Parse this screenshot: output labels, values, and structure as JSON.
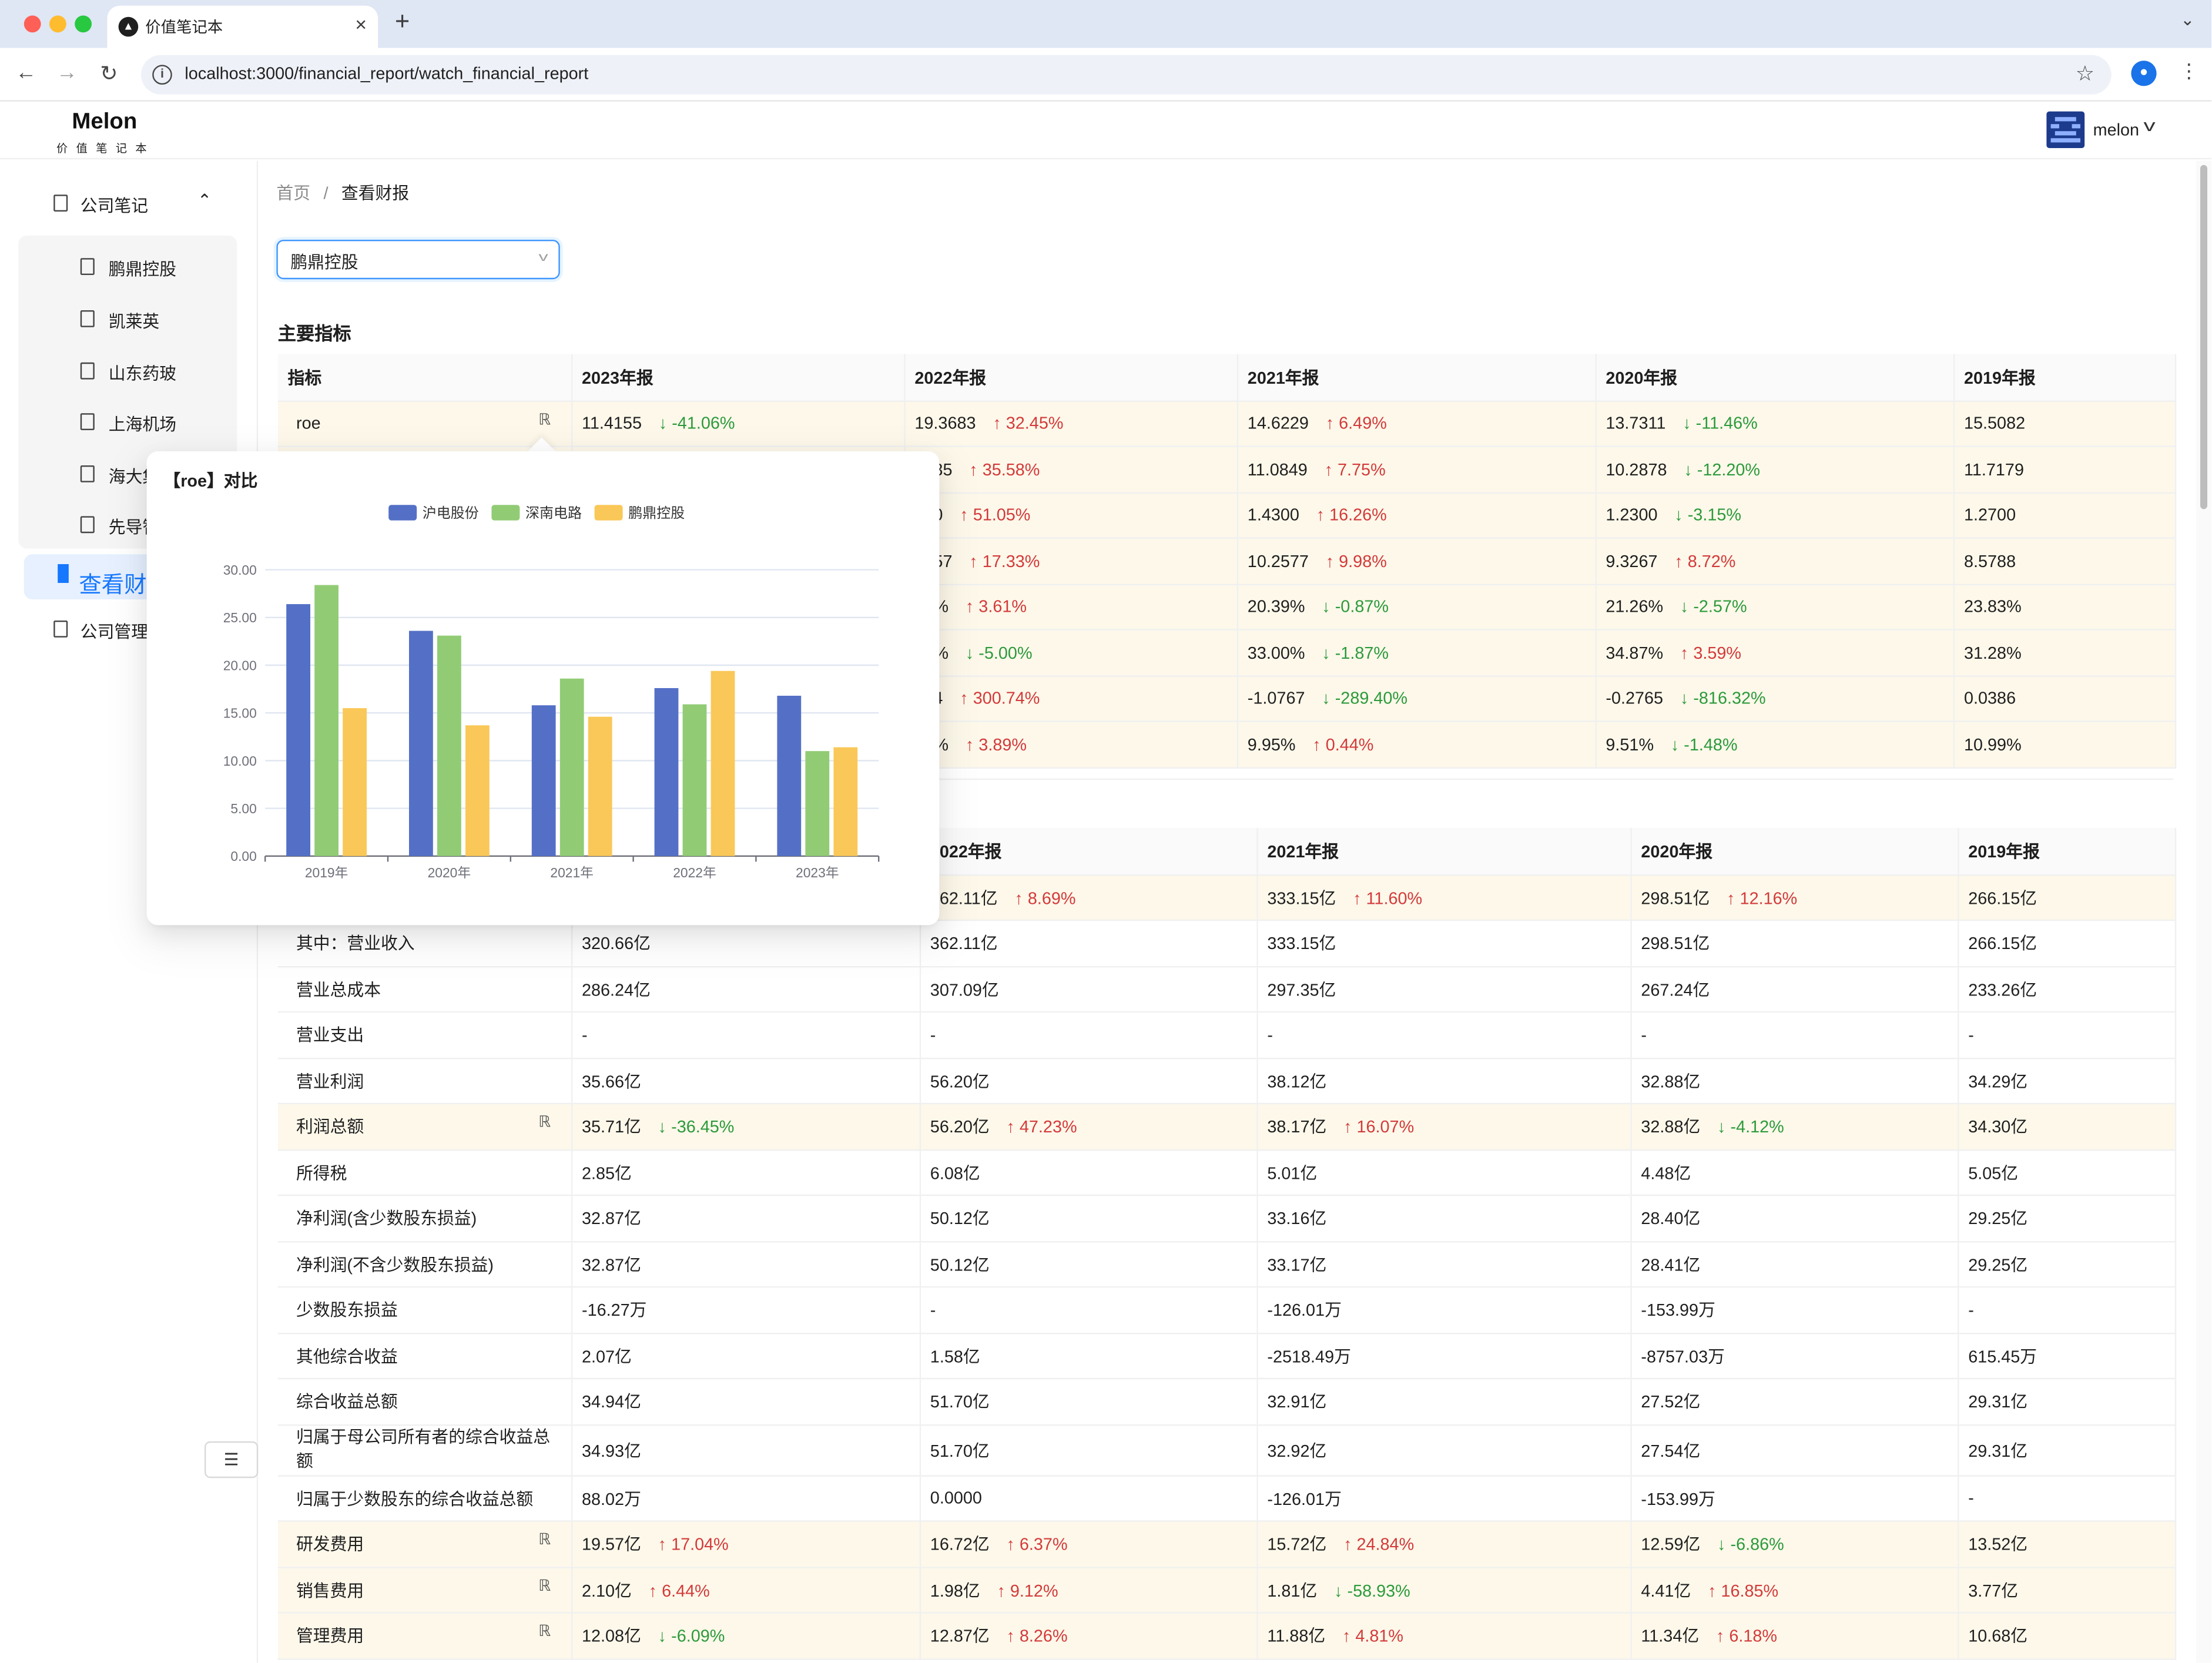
{
  "browser": {
    "tab_title": "价值笔记本",
    "url": "localhost:3000/financial_report/watch_financial_report",
    "profile_initial": "●"
  },
  "app": {
    "logo": "Melon",
    "logo_sub": "价值笔记本",
    "username": "melon"
  },
  "sidebar": {
    "group_label": "公司笔记",
    "companies": [
      "鹏鼎控股",
      "凯莱英",
      "山东药玻",
      "上海机场",
      "海大集团",
      "先导智能"
    ],
    "watch_report": "查看财报",
    "company_manage": "公司管理"
  },
  "breadcrumb": {
    "home": "首页",
    "separator": "/",
    "current": "查看财报"
  },
  "select": {
    "value": "鹏鼎控股"
  },
  "section_title": "主要指标",
  "indicators": {
    "headers": [
      "指标",
      "2023年报",
      "2022年报",
      "2021年报",
      "2020年报",
      "2019年报"
    ],
    "rows": [
      {
        "label": "roe",
        "cells": [
          {
            "v": "11.4155",
            "c": "-41.06%",
            "d": "down"
          },
          {
            "v": "19.3683",
            "c": "32.45%",
            "d": "up"
          },
          {
            "v": "14.6229",
            "c": "6.49%",
            "d": "up"
          },
          {
            "v": "13.7311",
            "c": "-11.46%",
            "d": "down"
          },
          {
            "v": "15.5082"
          }
        ]
      },
      {
        "label": "",
        "cells": [
          {
            "v": "0285",
            "c": "35.58%",
            "d": "up"
          },
          {
            "v": "11.0849",
            "c": "7.75%",
            "d": "up"
          },
          {
            "v": "10.2878",
            "c": "-12.20%",
            "d": "down"
          },
          {
            "v": "11.7179"
          }
        ]
      },
      {
        "label": "",
        "cells": [
          {
            "v": "600",
            "c": "51.05%",
            "d": "up"
          },
          {
            "v": "1.4300",
            "c": "16.26%",
            "d": "up"
          },
          {
            "v": "1.2300",
            "c": "-3.15%",
            "d": "down"
          },
          {
            "v": "1.2700"
          }
        ]
      },
      {
        "label": "",
        "cells": [
          {
            "v": "0357",
            "c": "17.33%",
            "d": "up"
          },
          {
            "v": "10.2577",
            "c": "9.98%",
            "d": "up"
          },
          {
            "v": "9.3267",
            "c": "8.72%",
            "d": "up"
          },
          {
            "v": "8.5788"
          }
        ]
      },
      {
        "label": "",
        "cells": [
          {
            "v": "00%",
            "c": "3.61%",
            "d": "up"
          },
          {
            "v": "20.39%",
            "c": "-0.87%",
            "d": "down"
          },
          {
            "v": "21.26%",
            "c": "-2.57%",
            "d": "down"
          },
          {
            "v": "23.83%"
          }
        ]
      },
      {
        "label": "",
        "cells": [
          {
            "v": "00%",
            "c": "-5.00%",
            "d": "down"
          },
          {
            "v": "33.00%",
            "c": "-1.87%",
            "d": "down"
          },
          {
            "v": "34.87%",
            "c": "3.59%",
            "d": "up"
          },
          {
            "v": "31.28%"
          }
        ]
      },
      {
        "label": "",
        "cells": [
          {
            "v": "614",
            "c": "300.74%",
            "d": "up"
          },
          {
            "v": "-1.0767",
            "c": "-289.40%",
            "d": "down"
          },
          {
            "v": "-0.2765",
            "c": "-816.32%",
            "d": "down"
          },
          {
            "v": "0.0386"
          }
        ]
      },
      {
        "label": "",
        "cells": [
          {
            "v": "84%",
            "c": "3.89%",
            "d": "up"
          },
          {
            "v": "9.95%",
            "c": "0.44%",
            "d": "up"
          },
          {
            "v": "9.51%",
            "c": "-1.48%",
            "d": "down"
          },
          {
            "v": "10.99%"
          }
        ]
      }
    ]
  },
  "income": {
    "headers": [
      "",
      "",
      "2022年报",
      "2021年报",
      "2020年报",
      "2019年报"
    ],
    "rows": [
      {
        "label": "",
        "hl": true,
        "cells": [
          {
            "v": ""
          },
          {
            "v": "362.11亿",
            "c": "8.69%",
            "d": "up"
          },
          {
            "v": "333.15亿",
            "c": "11.60%",
            "d": "up"
          },
          {
            "v": "298.51亿",
            "c": "12.16%",
            "d": "up"
          },
          {
            "v": "266.15亿"
          }
        ]
      },
      {
        "label": "其中：营业收入",
        "cells": [
          {
            "v": "320.66亿"
          },
          {
            "v": "362.11亿"
          },
          {
            "v": "333.15亿"
          },
          {
            "v": "298.51亿"
          },
          {
            "v": "266.15亿"
          }
        ]
      },
      {
        "label": "营业总成本",
        "cells": [
          {
            "v": "286.24亿"
          },
          {
            "v": "307.09亿"
          },
          {
            "v": "297.35亿"
          },
          {
            "v": "267.24亿"
          },
          {
            "v": "233.26亿"
          }
        ]
      },
      {
        "label": "营业支出",
        "cells": [
          {
            "v": "-"
          },
          {
            "v": "-"
          },
          {
            "v": "-"
          },
          {
            "v": "-"
          },
          {
            "v": "-"
          }
        ]
      },
      {
        "label": "营业利润",
        "cells": [
          {
            "v": "35.66亿"
          },
          {
            "v": "56.20亿"
          },
          {
            "v": "38.12亿"
          },
          {
            "v": "32.88亿"
          },
          {
            "v": "34.29亿"
          }
        ]
      },
      {
        "label": "利润总额",
        "hl": true,
        "icon": true,
        "cells": [
          {
            "v": "35.71亿",
            "c": "-36.45%",
            "d": "down"
          },
          {
            "v": "56.20亿",
            "c": "47.23%",
            "d": "up"
          },
          {
            "v": "38.17亿",
            "c": "16.07%",
            "d": "up"
          },
          {
            "v": "32.88亿",
            "c": "-4.12%",
            "d": "down"
          },
          {
            "v": "34.30亿"
          }
        ]
      },
      {
        "label": "所得税",
        "cells": [
          {
            "v": "2.85亿"
          },
          {
            "v": "6.08亿"
          },
          {
            "v": "5.01亿"
          },
          {
            "v": "4.48亿"
          },
          {
            "v": "5.05亿"
          }
        ]
      },
      {
        "label": "净利润(含少数股东损益)",
        "cells": [
          {
            "v": "32.87亿"
          },
          {
            "v": "50.12亿"
          },
          {
            "v": "33.16亿"
          },
          {
            "v": "28.40亿"
          },
          {
            "v": "29.25亿"
          }
        ]
      },
      {
        "label": "净利润(不含少数股东损益)",
        "cells": [
          {
            "v": "32.87亿"
          },
          {
            "v": "50.12亿"
          },
          {
            "v": "33.17亿"
          },
          {
            "v": "28.41亿"
          },
          {
            "v": "29.25亿"
          }
        ]
      },
      {
        "label": "少数股东损益",
        "cells": [
          {
            "v": "-16.27万"
          },
          {
            "v": "-"
          },
          {
            "v": "-126.01万"
          },
          {
            "v": "-153.99万"
          },
          {
            "v": "-"
          }
        ]
      },
      {
        "label": "其他综合收益",
        "cells": [
          {
            "v": "2.07亿"
          },
          {
            "v": "1.58亿"
          },
          {
            "v": "-2518.49万"
          },
          {
            "v": "-8757.03万"
          },
          {
            "v": "615.45万"
          }
        ]
      },
      {
        "label": "综合收益总额",
        "cells": [
          {
            "v": "34.94亿"
          },
          {
            "v": "51.70亿"
          },
          {
            "v": "32.91亿"
          },
          {
            "v": "27.52亿"
          },
          {
            "v": "29.31亿"
          }
        ]
      },
      {
        "label": "归属于母公司所有者的综合收益总额",
        "tall": true,
        "cells": [
          {
            "v": "34.93亿"
          },
          {
            "v": "51.70亿"
          },
          {
            "v": "32.92亿"
          },
          {
            "v": "27.54亿"
          },
          {
            "v": "29.31亿"
          }
        ]
      },
      {
        "label": "归属于少数股东的综合收益总额",
        "cells": [
          {
            "v": "88.02万"
          },
          {
            "v": "0.0000"
          },
          {
            "v": "-126.01万"
          },
          {
            "v": "-153.99万"
          },
          {
            "v": "-"
          }
        ]
      },
      {
        "label": "研发费用",
        "hl": true,
        "icon": true,
        "cells": [
          {
            "v": "19.57亿",
            "c": "17.04%",
            "d": "up"
          },
          {
            "v": "16.72亿",
            "c": "6.37%",
            "d": "up"
          },
          {
            "v": "15.72亿",
            "c": "24.84%",
            "d": "up"
          },
          {
            "v": "12.59亿",
            "c": "-6.86%",
            "d": "down"
          },
          {
            "v": "13.52亿"
          }
        ]
      },
      {
        "label": "销售费用",
        "hl": true,
        "icon": true,
        "cells": [
          {
            "v": "2.10亿",
            "c": "6.44%",
            "d": "up"
          },
          {
            "v": "1.98亿",
            "c": "9.12%",
            "d": "up"
          },
          {
            "v": "1.81亿",
            "c": "-58.93%",
            "d": "down"
          },
          {
            "v": "4.41亿",
            "c": "16.85%",
            "d": "up"
          },
          {
            "v": "3.77亿"
          }
        ]
      },
      {
        "label": "管理费用",
        "hl": true,
        "icon": true,
        "cells": [
          {
            "v": "12.08亿",
            "c": "-6.09%",
            "d": "down"
          },
          {
            "v": "12.87亿",
            "c": "8.26%",
            "d": "up"
          },
          {
            "v": "11.88亿",
            "c": "4.81%",
            "d": "up"
          },
          {
            "v": "11.34亿",
            "c": "6.18%",
            "d": "up"
          },
          {
            "v": "10.68亿"
          }
        ]
      }
    ]
  },
  "icons": {
    "compare": "compare-icon",
    "arrow_up": "↑",
    "arrow_down": "↓"
  },
  "colors": {
    "up": "#d33a3a",
    "down": "#2c9a3b",
    "highlight_row": "#fdf8ea",
    "accent": "#4096ff"
  },
  "popover_title": "【roe】对比",
  "chart_data": {
    "type": "bar",
    "categories": [
      "2019年",
      "2020年",
      "2021年",
      "2022年",
      "2023年"
    ],
    "series": [
      {
        "name": "沪电股份",
        "color": "#5470c6",
        "values": [
          26.4,
          23.6,
          15.8,
          17.6,
          16.8
        ]
      },
      {
        "name": "深南电路",
        "color": "#91cc75",
        "values": [
          28.4,
          23.1,
          18.6,
          15.9,
          11.0
        ]
      },
      {
        "name": "鹏鼎控股",
        "color": "#fac858",
        "values": [
          15.5,
          13.7,
          14.6,
          19.4,
          11.4
        ]
      }
    ],
    "yticks": [
      "0.00",
      "5.00",
      "10.00",
      "15.00",
      "20.00",
      "25.00",
      "30.00"
    ],
    "ylim": [
      0,
      30
    ],
    "legend": "top-center",
    "grid": true
  }
}
